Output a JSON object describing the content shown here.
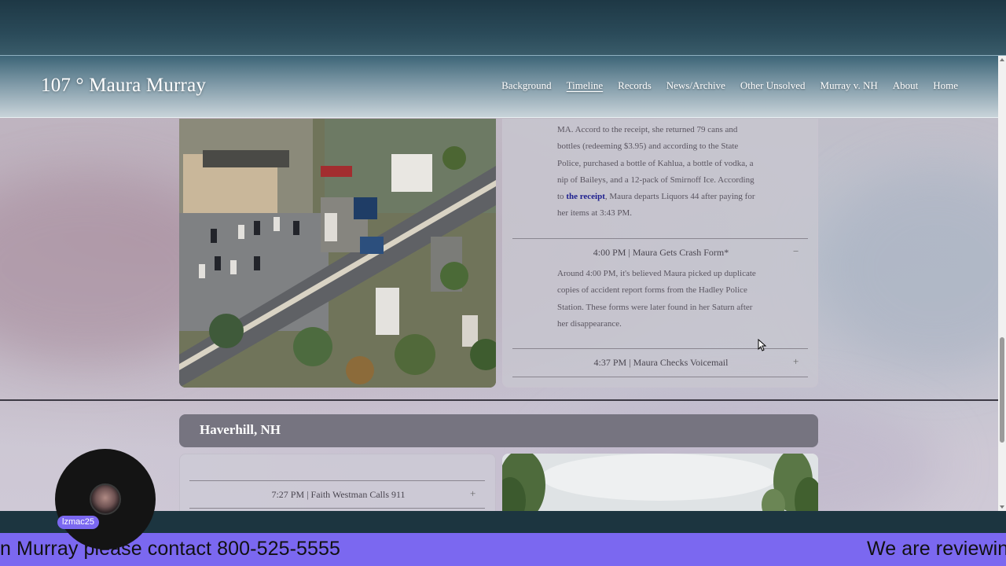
{
  "site": {
    "brand": "107 ° Maura Murray",
    "nav": [
      "Background",
      "Timeline",
      "Records",
      "News/Archive",
      "Other Unsolved",
      "Murray v. NH",
      "About",
      "Home"
    ],
    "active_nav": "Timeline"
  },
  "timeline": {
    "receipt_paragraph": {
      "line1": "MA. Accord to the receipt, she returned 79 cans and",
      "line2": "bottles (redeeming $3.95) and according to the State",
      "line3": "Police, purchased a bottle of Kahlua, a bottle of vodka, a",
      "line4": "nip of Baileys, and a 12-pack of Smirnoff Ice. According",
      "line5_pre": "to ",
      "line5_link": "the receipt",
      "line5_post": ", Maura departs Liquors 44 after paying for",
      "line6": "her items at 3:43 PM."
    },
    "crash_form": {
      "title": "4:00 PM | Maura Gets Crash Form*",
      "toggle": "−",
      "line1": "Around 4:00 PM, it's believed Maura picked up duplicate",
      "line2": "copies of accident report forms from the Hadley Police",
      "line3": "Station. These forms were later found in her Saturn after",
      "line4": "her disappearance."
    },
    "voicemail": {
      "title": "4:37 PM | Maura Checks Voicemail",
      "toggle": "+"
    }
  },
  "haverhill": {
    "heading": "Haverhill, NH",
    "item_title": "7:27 PM | Faith Westman Calls 911",
    "item_toggle": "+"
  },
  "stream": {
    "ticker_left": "n Murray please contact 800-525-5555",
    "ticker_right": "We are reviewin",
    "username": "lzmac25"
  }
}
